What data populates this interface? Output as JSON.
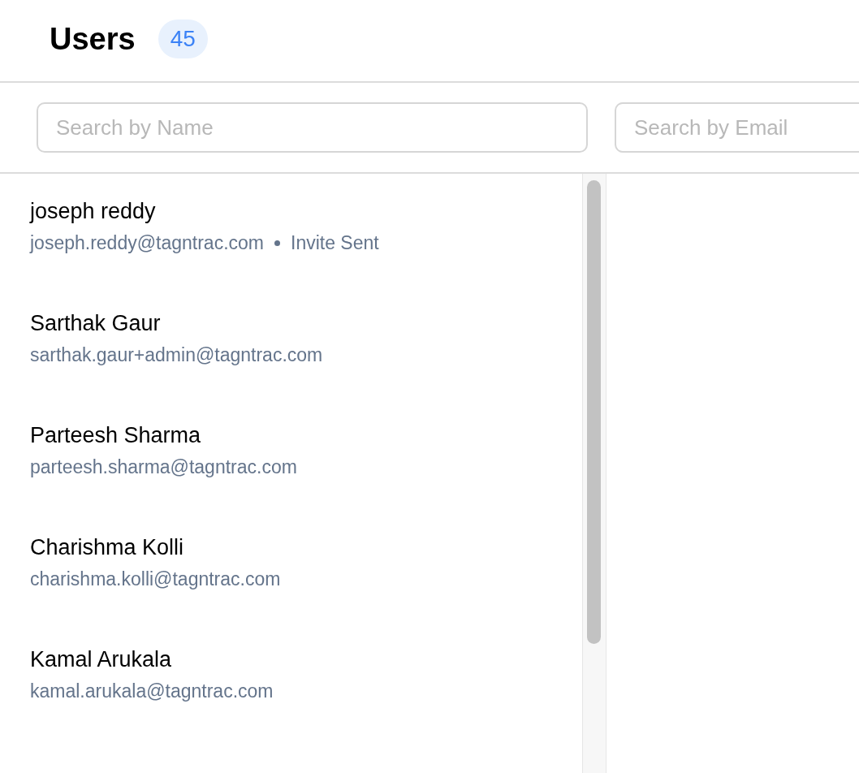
{
  "header": {
    "title": "Users",
    "count": "45"
  },
  "filters": [
    {
      "placeholder": "Search by Name"
    },
    {
      "placeholder": "Search by Email"
    }
  ],
  "users": [
    {
      "name": "joseph reddy",
      "email": "joseph.reddy@tagntrac.com",
      "status": "Invite Sent"
    },
    {
      "name": "Sarthak Gaur",
      "email": "sarthak.gaur+admin@tagntrac.com"
    },
    {
      "name": "Parteesh Sharma",
      "email": "parteesh.sharma@tagntrac.com"
    },
    {
      "name": "Charishma Kolli",
      "email": "charishma.kolli@tagntrac.com"
    },
    {
      "name": "Kamal Arukala",
      "email": "kamal.arukala@tagntrac.com"
    }
  ]
}
